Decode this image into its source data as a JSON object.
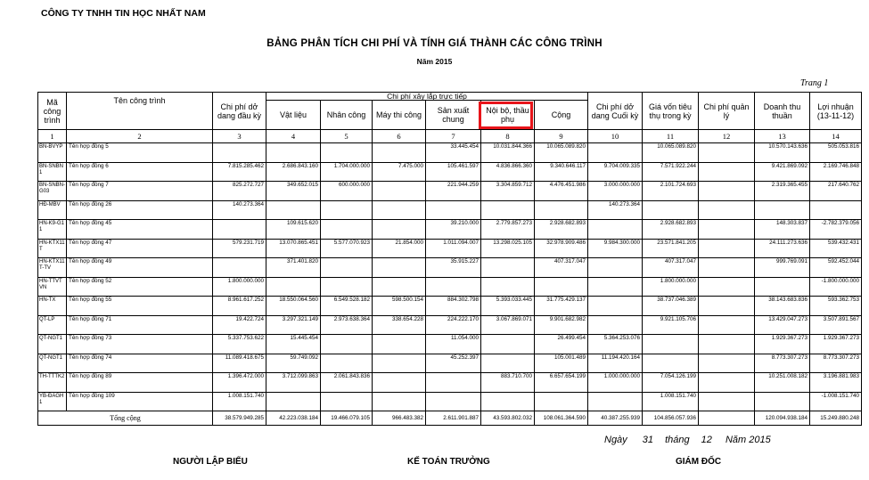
{
  "company": "CÔNG TY TNHH TIN HỌC NHẤT NAM",
  "title": "BẢNG PHÂN TÍCH CHI PHÍ VÀ TÍNH GIÁ THÀNH CÁC CÔNG TRÌNH",
  "year_label": "Năm 2015",
  "page_label": "Trang 1",
  "headers": {
    "ma": "Mã công trình",
    "ten": "Tên công trình",
    "cp_dau_ky": "Chi phí dở dang đầu kỳ",
    "cp_xay_lap": "Chi phí xây lắp trực tiếp",
    "vat_lieu": "Vật liệu",
    "nhan_cong": "Nhân công",
    "may_thi_cong": "Máy thi công",
    "san_xuat_chung": "Sản xuất chung",
    "noi_bo": "Nội bộ, thầu phụ",
    "cong": "Cộng",
    "cp_cuoi_ky": "Chi phí dở dang Cuối kỳ",
    "gia_von": "Giá vốn tiêu thụ trong kỳ",
    "cp_quan_ly": "Chi phí quản lý",
    "doanh_thu": "Doanh thu thuần",
    "loi_nhuan": "Lợi nhuận (13-11-12)"
  },
  "col_numbers": [
    "1",
    "2",
    "3",
    "4",
    "5",
    "6",
    "7",
    "8",
    "9",
    "10",
    "11",
    "12",
    "13",
    "14"
  ],
  "rows": [
    [
      "BN-BVYP",
      "Tên hợp đồng 5",
      "",
      "",
      "",
      "",
      "33.445.454",
      "10.031.844.366",
      "10.065.089.820",
      "",
      "10.065.089.820",
      "",
      "10.570.143.636",
      "505.053.816"
    ],
    [
      "BN-SNBN1",
      "Tên hợp đồng 6",
      "7.815.285.462",
      "2.686.843.160",
      "1.704.000.000",
      "7.475.000",
      "105.461.597",
      "4.836.866.360",
      "9.340.646.117",
      "9.704.009.335",
      "7.571.922.244",
      "",
      "9.421.869.092",
      "2.169.746.848"
    ],
    [
      "BN-SNBN-G03",
      "Tên hợp đồng 7",
      "825.272.727",
      "349.652.015",
      "600.000.000",
      "",
      "221.944.259",
      "3.304.859.712",
      "4.476.451.986",
      "3.000.000.000",
      "2.101.724.693",
      "",
      "2.319.365.455",
      "217.640.762"
    ],
    [
      "HĐ-MBV",
      "Tên hợp đồng 26",
      "140.273.364",
      "",
      "",
      "",
      "",
      "",
      "",
      "140.273.364",
      "",
      "",
      "",
      ""
    ],
    [
      "HN-K9-G11",
      "Tên hợp đồng 45",
      "",
      "109.615.620",
      "",
      "",
      "39.210.000",
      "2.779.857.273",
      "2.928.682.893",
      "",
      "2.928.682.893",
      "",
      "148.303.837",
      "-2.782.379.056"
    ],
    [
      "HN-KTX11T",
      "Tên hợp đồng 47",
      "579.231.719",
      "13.070.865.451",
      "5.577.070.923",
      "21.854.000",
      "1.011.094.007",
      "13.298.025.105",
      "32.978.909.486",
      "9.984.300.000",
      "23.571.841.205",
      "",
      "24.111.273.636",
      "539.432.431"
    ],
    [
      "HN-KTX11T-TV",
      "Tên hợp đồng 49",
      "",
      "371.401.820",
      "",
      "",
      "35.915.227",
      "",
      "407.317.047",
      "",
      "407.317.047",
      "",
      "999.769.091",
      "592.452.044"
    ],
    [
      "HN-TTVTVN",
      "Tên hợp đồng 52",
      "1.800.000.000",
      "",
      "",
      "",
      "",
      "",
      "",
      "",
      "1.800.000.000",
      "",
      "",
      "-1.800.000.000"
    ],
    [
      "HN-TX",
      "Tên hợp đồng 55",
      "8.961.617.252",
      "18.550.064.560",
      "6.549.528.182",
      "598.500.154",
      "884.302.798",
      "5.393.033.445",
      "31.775.429.137",
      "",
      "38.737.046.389",
      "",
      "38.143.683.836",
      "593.362.753"
    ],
    [
      "QT-LP",
      "Tên hợp đồng 71",
      "19.422.724",
      "3.297.321.149",
      "2.973.638.364",
      "338.654.228",
      "224.222.170",
      "3.067.869.071",
      "9.901.682.982",
      "",
      "9.921.105.706",
      "",
      "13.429.047.273",
      "3.507.891.567"
    ],
    [
      "QT-NGT1",
      "Tên hợp đồng 73",
      "5.337.753.622",
      "15.445.454",
      "",
      "",
      "11.054.000",
      "",
      "26.499.454",
      "5.364.253.076",
      "",
      "",
      "1.929.367.273",
      "1.929.367.273"
    ],
    [
      "QT-NGT1",
      "Tên hợp đồng 74",
      "11.089.418.675",
      "59.749.092",
      "",
      "",
      "45.252.397",
      "",
      "105.001.489",
      "11.194.420.164",
      "",
      "",
      "8.773.307.273",
      "8.773.307.273"
    ],
    [
      "TH-TTTK2",
      "Tên hợp đồng 89",
      "1.396.472.000",
      "3.712.099.863",
      "2.061.843.836",
      "",
      "",
      "883.710.700",
      "6.657.654.199",
      "1.000.000.000",
      "7.054.126.199",
      "",
      "10.251.008.182",
      "3.196.881.983"
    ],
    [
      "YB-ĐAGH1",
      "Tên hợp đồng 109",
      "1.008.151.740",
      "",
      "",
      "",
      "",
      "",
      "",
      "",
      "1.008.151.740",
      "",
      "",
      "-1.008.151.740"
    ]
  ],
  "total": {
    "label": "Tổng cộng",
    "values": [
      "38.579.949.285",
      "42.223.038.184",
      "19.466.079.105",
      "966.483.382",
      "2.611.901.887",
      "43.593.802.032",
      "108.061.364.590",
      "40.387.255.939",
      "104.856.057.936",
      "",
      "120.094.938.184",
      "15.249.880.248"
    ]
  },
  "date_line": {
    "prefix": "Ngày",
    "day": "31",
    "month_label": "tháng",
    "month": "12",
    "year_label": "Năm",
    "year": "2015"
  },
  "signatures": {
    "preparer": "NGƯỜI LẬP BIỂU",
    "accountant": "KẾ TOÁN TRƯỞNG",
    "director": "GIÁM ĐỐC"
  },
  "colors": {
    "highlight": "#e8141a"
  }
}
